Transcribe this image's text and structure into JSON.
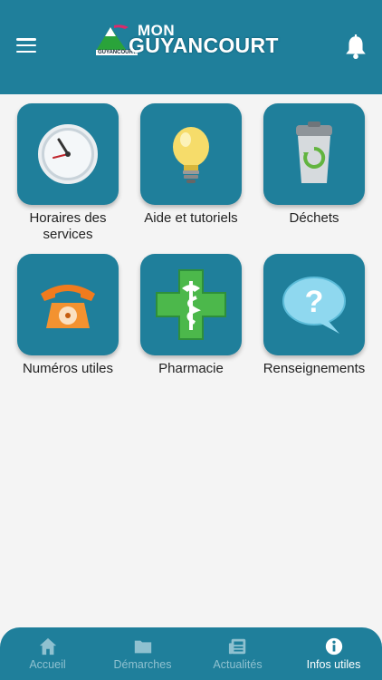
{
  "header": {
    "logo_prefix": "MON",
    "logo_main": "GUYANCOURT",
    "logo_small": "GUYANCOURT",
    "menu_icon": "hamburger-menu-icon",
    "notification_icon": "bell-icon"
  },
  "tiles": [
    {
      "label": "Horaires des services",
      "icon": "clock-icon"
    },
    {
      "label": "Aide et tutoriels",
      "icon": "lightbulb-icon"
    },
    {
      "label": "Déchets",
      "icon": "recycle-bin-icon"
    },
    {
      "label": "Numéros utiles",
      "icon": "telephone-icon"
    },
    {
      "label": "Pharmacie",
      "icon": "pharmacy-cross-icon"
    },
    {
      "label": "Renseignements",
      "icon": "question-bubble-icon"
    }
  ],
  "tabbar": {
    "tabs": [
      {
        "label": "Accueil",
        "icon": "home-icon"
      },
      {
        "label": "Démarches",
        "icon": "folder-icon"
      },
      {
        "label": "Actualités",
        "icon": "newspaper-icon"
      },
      {
        "label": "Infos utiles",
        "icon": "info-icon"
      }
    ],
    "active": "Infos utiles"
  },
  "colors": {
    "primary": "#1f7f9b",
    "background": "#f4f4f4",
    "tab_inactive": "#8fc1d0",
    "tab_active": "#ffffff"
  }
}
